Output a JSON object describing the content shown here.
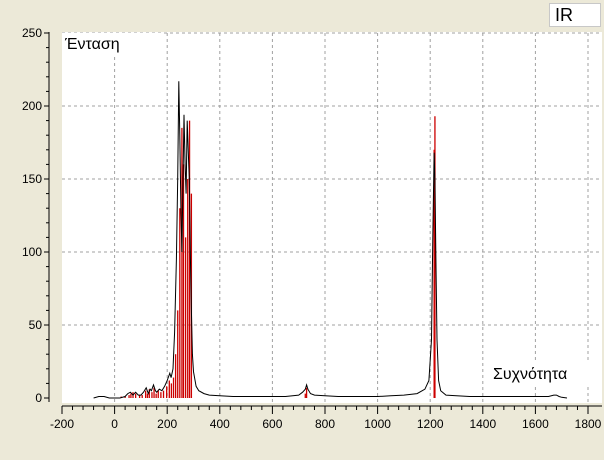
{
  "badge": "IR",
  "chart_data": {
    "type": "line",
    "title": "",
    "xlabel": "Συχνότητα",
    "ylabel": "Ένταση",
    "xlim": [
      -200,
      1800
    ],
    "ylim": [
      0,
      250
    ],
    "x_ticks": [
      -200,
      0,
      200,
      400,
      600,
      800,
      1000,
      1200,
      1400,
      1600,
      1800
    ],
    "y_ticks": [
      0,
      50,
      100,
      150,
      200,
      250
    ],
    "grid": true,
    "series": [
      {
        "color": "#000000",
        "x": [
          -80,
          -60,
          -40,
          -20,
          0,
          20,
          40,
          50,
          60,
          70,
          80,
          90,
          100,
          110,
          120,
          128,
          135,
          140,
          148,
          155,
          160,
          170,
          180,
          190,
          200,
          210,
          215,
          222,
          228,
          235,
          240,
          244,
          248,
          252,
          256,
          260,
          264,
          268,
          272,
          276,
          280,
          284,
          288,
          292,
          296,
          300,
          310,
          320,
          340,
          360,
          400,
          450,
          500,
          550,
          600,
          650,
          700,
          715,
          725,
          730,
          735,
          745,
          760,
          800,
          850,
          900,
          950,
          1000,
          1050,
          1100,
          1150,
          1180,
          1195,
          1205,
          1210,
          1215,
          1218,
          1222,
          1226,
          1232,
          1240,
          1260,
          1300,
          1350,
          1400,
          1450,
          1500,
          1550,
          1600,
          1650,
          1670,
          1680,
          1690,
          1700,
          1720
        ],
        "y": [
          0,
          1,
          1,
          0,
          0,
          0,
          1,
          3,
          4,
          2,
          4,
          2,
          2,
          4,
          7,
          3,
          6,
          5,
          9,
          5,
          4,
          6,
          5,
          8,
          12,
          17,
          14,
          20,
          45,
          95,
          150,
          217,
          180,
          130,
          100,
          150,
          194,
          160,
          140,
          190,
          170,
          150,
          100,
          60,
          30,
          18,
          8,
          5,
          3,
          2,
          1.5,
          1,
          1,
          1,
          1,
          1,
          2,
          4,
          6,
          9,
          6,
          3,
          2,
          1.5,
          1,
          1,
          1,
          1,
          1.5,
          2,
          3,
          6,
          12,
          40,
          110,
          168,
          150,
          90,
          40,
          12,
          5,
          2,
          1.5,
          1,
          1,
          1,
          1,
          1,
          1,
          1,
          2,
          2,
          1,
          0.5,
          0
        ]
      },
      {
        "color": "#cc0000",
        "x": [
          25,
          40,
          55,
          62,
          70,
          80,
          95,
          105,
          118,
          125,
          132,
          142,
          150,
          158,
          166,
          176,
          186,
          198,
          208,
          216,
          224,
          232,
          240,
          248,
          256,
          262,
          270,
          278,
          285,
          292,
          725,
          730,
          1215,
          1218
        ],
        "y": [
          1,
          1,
          2,
          3,
          4,
          3,
          2,
          2,
          5,
          3,
          6,
          4,
          7,
          3,
          5,
          4,
          5,
          8,
          12,
          10,
          14,
          30,
          60,
          130,
          185,
          160,
          110,
          150,
          190,
          140,
          3,
          7,
          170,
          193
        ]
      }
    ]
  }
}
